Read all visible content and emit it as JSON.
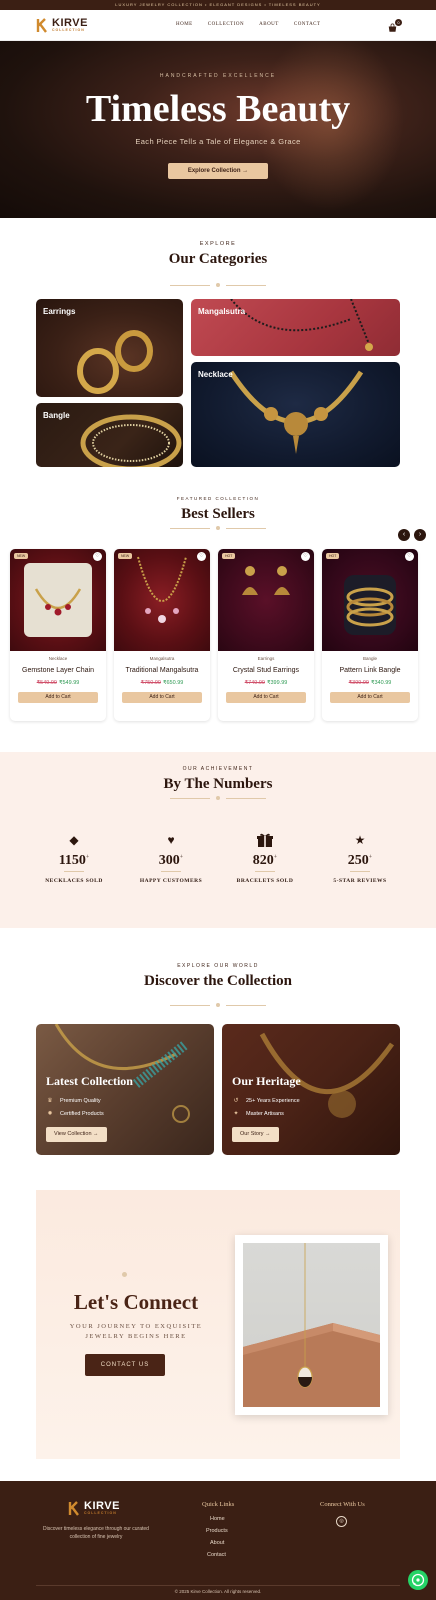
{
  "announcement": "LUXURY JEWELRY COLLECTION • ELEGANT DESIGNS • TIMELESS BEAUTY",
  "nav": {
    "logo_name": "KIRVE",
    "logo_sub": "COLLECTION",
    "links": [
      "HOME",
      "COLLECTION",
      "ABOUT",
      "CONTACT"
    ],
    "cart_count": "0"
  },
  "hero": {
    "eyebrow": "HANDCRAFTED EXCELLENCE",
    "title": "Timeless Beauty",
    "subtitle": "Each Piece Tells a Tale of Elegance & Grace",
    "cta": "Explore Collection →"
  },
  "categories": {
    "eyebrow": "EXPLORE",
    "title": "Our Categories",
    "items": [
      "Earrings",
      "Mangalsutra",
      "Necklace",
      "Bangle"
    ]
  },
  "bestsellers": {
    "eyebrow": "FEATURED COLLECTION",
    "title": "Best Sellers",
    "prev": "‹",
    "next": "›",
    "products": [
      {
        "badge": "NEW",
        "category": "Necklace",
        "name": "Gemstone Layer Chain",
        "old_price": "₹549.99",
        "price": "₹549.99",
        "cta": "Add to Cart"
      },
      {
        "badge": "NEW",
        "category": "Mangalsutra",
        "name": "Traditional Mangalsutra",
        "old_price": "₹750.99",
        "price": "₹650.99",
        "cta": "Add to Cart"
      },
      {
        "badge": "HOT",
        "category": "Earrings",
        "name": "Crystal Stud Earrings",
        "old_price": "₹749.99",
        "price": "₹399.99",
        "cta": "Add to Cart"
      },
      {
        "badge": "HOT",
        "category": "Bangle",
        "name": "Pattern Link Bangle",
        "old_price": "₹399.99",
        "price": "₹340.99",
        "cta": "Add to Cart"
      }
    ]
  },
  "numbers": {
    "eyebrow": "OUR ACHIEVEMENT",
    "title": "By The Numbers",
    "stats": [
      {
        "value": "1150",
        "sup": "+",
        "label": "NECKLACES SOLD",
        "icon": "diamond-icon"
      },
      {
        "value": "300",
        "sup": "+",
        "label": "HAPPY CUSTOMERS",
        "icon": "heart-icon"
      },
      {
        "value": "820",
        "sup": "+",
        "label": "BRACELETS SOLD",
        "icon": "gift-icon"
      },
      {
        "value": "250",
        "sup": "+",
        "label": "5-STAR REVIEWS",
        "icon": "star-icon"
      }
    ]
  },
  "discover": {
    "eyebrow": "EXPLORE OUR WORLD",
    "title": "Discover the Collection",
    "latest": {
      "title": "Latest Collection",
      "features": [
        "Premium Quality",
        "Certified Products"
      ],
      "cta": "View Collection →"
    },
    "heritage": {
      "title": "Our Heritage",
      "features": [
        "25+ Years Experience",
        "Master Artisans"
      ],
      "cta": "Our Story →"
    }
  },
  "connect": {
    "title": "Let's Connect",
    "subtitle_1": "YOUR JOURNEY TO EXQUISITE",
    "subtitle_2": "JEWELRY BEGINS HERE",
    "cta": "CONTACT US"
  },
  "footer": {
    "logo_name": "KIRVE",
    "logo_sub": "COLLECTION",
    "description": "Discover timeless elegance through our curated collection of fine jewelry",
    "quick_links_title": "Quick Links",
    "quick_links": [
      "Home",
      "Products",
      "About",
      "Contact"
    ],
    "connect_title": "Connect With Us",
    "copyright": "© 2025 Kirve Collection. All rights reserved."
  },
  "colors": {
    "brand_dark": "#3b1f14",
    "accent_gold": "#e9c7a0",
    "sale_red": "#d0506a",
    "price_green": "#2e9a53"
  }
}
